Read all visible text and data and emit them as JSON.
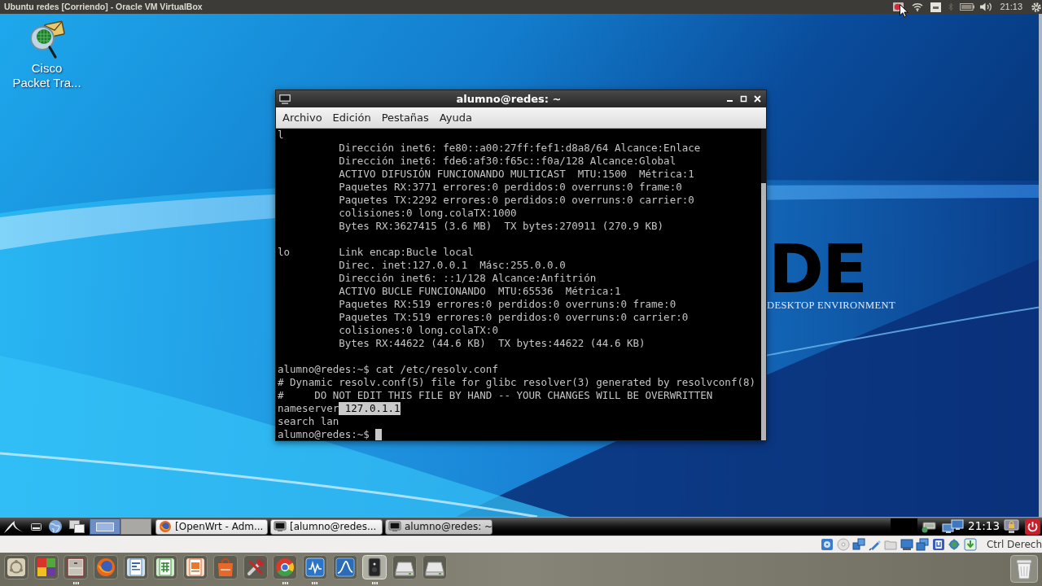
{
  "host_bar": {
    "title": "Ubuntu redes [Corriendo] - Oracle VM VirtualBox",
    "clock": "21:13"
  },
  "desktop": {
    "icons": [
      {
        "label": "Cisco Packet Tra..."
      }
    ],
    "wallpaper": {
      "logo": "DE",
      "tagline": "DESKTOP ENVIRONMENT"
    }
  },
  "terminal": {
    "title": "alumno@redes: ~",
    "menu": [
      {
        "label": "Archivo"
      },
      {
        "label": "Edición"
      },
      {
        "label": "Pestañas"
      },
      {
        "label": "Ayuda"
      }
    ],
    "lines": [
      {
        "kind": "plain",
        "text": "l"
      },
      {
        "kind": "detail",
        "text": "Dirección inet6: fe80::a00:27ff:fef1:d8a8/64 Alcance:Enlace"
      },
      {
        "kind": "detail",
        "text": "Dirección inet6: fde6:af30:f65c::f0a/128 Alcance:Global"
      },
      {
        "kind": "detail",
        "text": "ACTIVO DIFUSIÓN FUNCIONANDO MULTICAST  MTU:1500  Métrica:1"
      },
      {
        "kind": "detail",
        "text": "Paquetes RX:3771 errores:0 perdidos:0 overruns:0 frame:0"
      },
      {
        "kind": "detail",
        "text": "Paquetes TX:2292 errores:0 perdidos:0 overruns:0 carrier:0"
      },
      {
        "kind": "detail",
        "text": "colisiones:0 long.colaTX:1000"
      },
      {
        "kind": "detail",
        "text": "Bytes RX:3627415 (3.6 MB)  TX bytes:270911 (270.9 KB)"
      },
      {
        "kind": "blank"
      },
      {
        "kind": "iface",
        "name": "lo",
        "text": "Link encap:Bucle local"
      },
      {
        "kind": "detail",
        "text": "Direc. inet:127.0.0.1  Másc:255.0.0.0"
      },
      {
        "kind": "detail",
        "text": "Dirección inet6: ::1/128 Alcance:Anfitrión"
      },
      {
        "kind": "detail",
        "text": "ACTIVO BUCLE FUNCIONANDO  MTU:65536  Métrica:1"
      },
      {
        "kind": "detail",
        "text": "Paquetes RX:519 errores:0 perdidos:0 overruns:0 frame:0"
      },
      {
        "kind": "detail",
        "text": "Paquetes TX:519 errores:0 perdidos:0 overruns:0 carrier:0"
      },
      {
        "kind": "detail",
        "text": "colisiones:0 long.colaTX:0"
      },
      {
        "kind": "detail",
        "text": "Bytes RX:44622 (44.6 KB)  TX bytes:44622 (44.6 KB)"
      },
      {
        "kind": "blank"
      },
      {
        "kind": "plain",
        "text": "alumno@redes:~$ cat /etc/resolv.conf"
      },
      {
        "kind": "plain",
        "text": "# Dynamic resolv.conf(5) file for glibc resolver(3) generated by resolvconf(8)"
      },
      {
        "kind": "plain",
        "text": "#     DO NOT EDIT THIS FILE BY HAND -- YOUR CHANGES WILL BE OVERWRITTEN"
      },
      {
        "kind": "plain",
        "text": "nameserver",
        "selection": "127.0.1.1"
      },
      {
        "kind": "plain",
        "text": "search lan"
      },
      {
        "kind": "plain",
        "text": "alumno@redes:~$",
        "cursor": true
      }
    ]
  },
  "panel": {
    "desktops": [
      {
        "selected": true
      },
      {
        "selected": false
      }
    ],
    "tasks": [
      {
        "kind": "browser",
        "label": "[OpenWrt - Adm...",
        "selected": false
      },
      {
        "kind": "terminal",
        "label": "[alumno@redes...",
        "selected": false
      },
      {
        "kind": "terminal",
        "label": "alumno@redes: ~",
        "selected": true
      }
    ],
    "clock": "21:13"
  },
  "vm_status_bar": {
    "host_key": "Ctrl Derech"
  },
  "dock": {
    "items": [
      {
        "kind": "ubuntu",
        "running": false,
        "active": false
      },
      {
        "kind": "squares",
        "running": false,
        "active": false
      },
      {
        "kind": "cabinet",
        "running": true,
        "active": false
      },
      {
        "kind": "firefox",
        "running": false,
        "active": false
      },
      {
        "kind": "writer",
        "running": false,
        "active": false
      },
      {
        "kind": "calc",
        "running": false,
        "active": false
      },
      {
        "kind": "impress",
        "running": false,
        "active": false
      },
      {
        "kind": "store",
        "running": false,
        "active": false
      },
      {
        "kind": "tools",
        "running": false,
        "active": false
      },
      {
        "kind": "chrome",
        "running": true,
        "active": false
      },
      {
        "kind": "monitor",
        "running": true,
        "active": false
      },
      {
        "kind": "fin",
        "running": false,
        "active": false
      },
      {
        "kind": "device",
        "running": true,
        "active": true
      },
      {
        "kind": "drive",
        "running": false,
        "active": false
      },
      {
        "kind": "drive",
        "running": false,
        "active": false
      }
    ]
  }
}
